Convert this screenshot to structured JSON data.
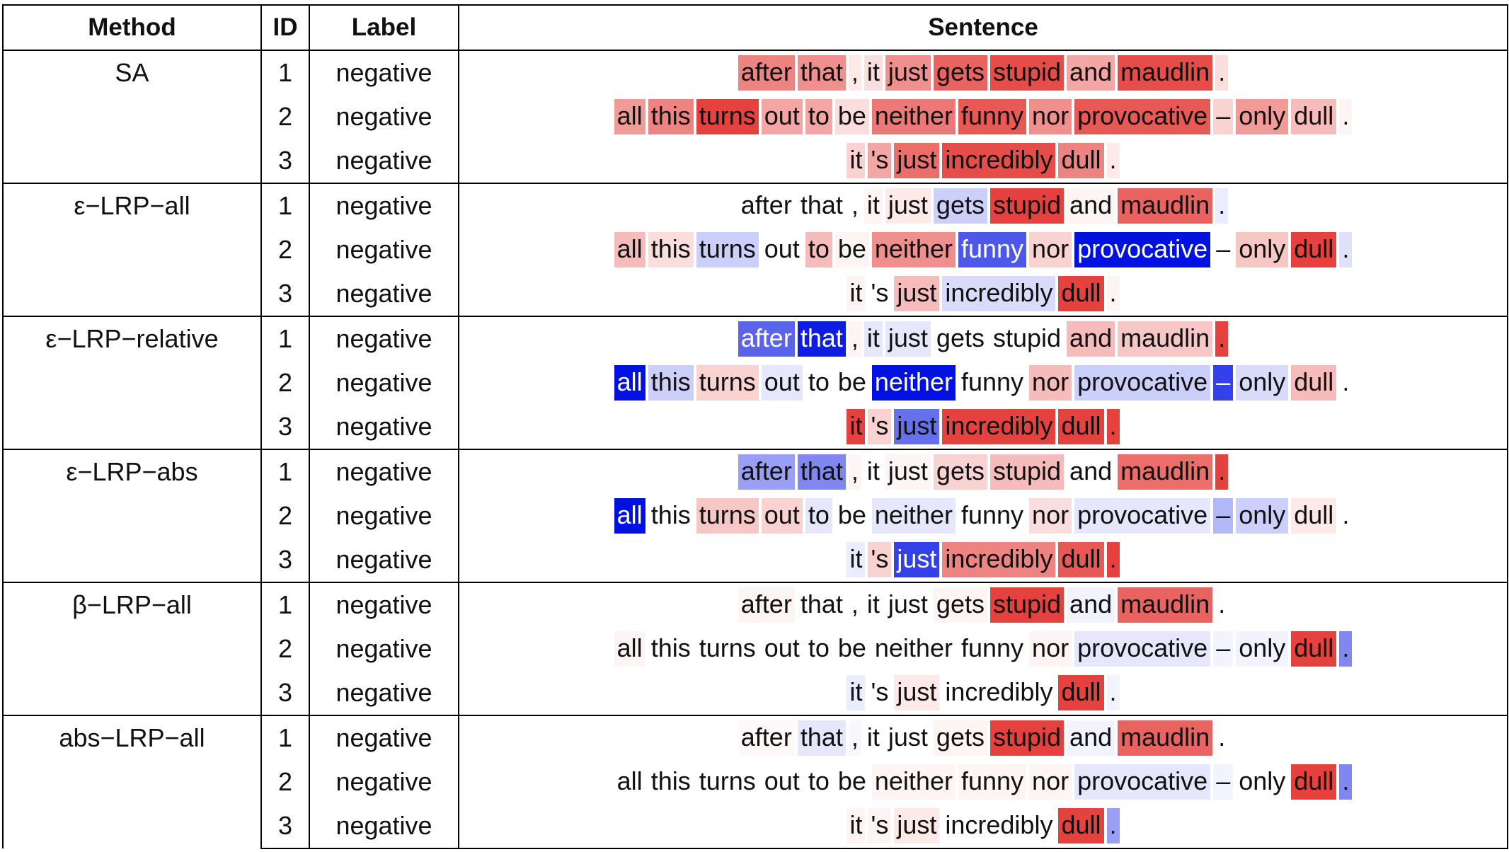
{
  "header": {
    "method": "Method",
    "id": "ID",
    "label": "Label",
    "sentence": "Sentence"
  },
  "sentences": [
    [
      "after",
      "that",
      ",",
      "it",
      "just",
      "gets",
      "stupid",
      "and",
      "maudlin",
      "."
    ],
    [
      "all",
      "this",
      "turns",
      "out",
      "to",
      "be",
      "neither",
      "funny",
      "nor",
      "provocative",
      "–",
      "only",
      "dull",
      "."
    ],
    [
      "it",
      "'s",
      "just",
      "incredibly",
      "dull",
      "."
    ]
  ],
  "methods": [
    {
      "name": "SA",
      "rows": [
        {
          "id": "1",
          "label": "negative",
          "weights": [
            0.55,
            0.5,
            0.1,
            0.15,
            0.5,
            0.7,
            0.8,
            0.4,
            0.8,
            0.15
          ]
        },
        {
          "id": "2",
          "label": "negative",
          "weights": [
            0.45,
            0.55,
            0.85,
            0.4,
            0.4,
            0.15,
            0.6,
            0.75,
            0.5,
            0.75,
            0.2,
            0.45,
            0.3,
            0.05
          ]
        },
        {
          "id": "3",
          "label": "negative",
          "weights": [
            0.2,
            0.4,
            0.65,
            0.8,
            0.55,
            0.1
          ]
        }
      ]
    },
    {
      "name": "ε−LRP−all",
      "rows": [
        {
          "id": "1",
          "label": "negative",
          "weights": [
            0,
            0,
            0,
            0.05,
            0.1,
            -0.2,
            0.85,
            0.05,
            0.7,
            -0.08
          ]
        },
        {
          "id": "2",
          "label": "negative",
          "weights": [
            0.3,
            0.15,
            -0.2,
            0,
            0.3,
            0.05,
            0.5,
            -0.7,
            0.2,
            -1.0,
            0,
            0.25,
            0.85,
            -0.12
          ]
        },
        {
          "id": "3",
          "label": "negative",
          "weights": [
            0.05,
            0,
            0.3,
            -0.15,
            0.85,
            0.05
          ]
        }
      ]
    },
    {
      "name": "ε−LRP−relative",
      "rows": [
        {
          "id": "1",
          "label": "negative",
          "weights": [
            -0.65,
            -0.95,
            0.05,
            -0.1,
            -0.1,
            0,
            0,
            0.3,
            0.25,
            0.85
          ]
        },
        {
          "id": "2",
          "label": "negative",
          "weights": [
            -1.0,
            -0.2,
            0.2,
            -0.1,
            0,
            0,
            -1.0,
            0,
            0.3,
            -0.2,
            -0.8,
            -0.15,
            0.3,
            0
          ]
        },
        {
          "id": "3",
          "label": "negative",
          "weights": [
            0.85,
            0.2,
            -0.6,
            0.85,
            0.85,
            0.85
          ]
        }
      ]
    },
    {
      "name": "ε−LRP−abs",
      "rows": [
        {
          "id": "1",
          "label": "negative",
          "weights": [
            -0.4,
            -0.5,
            0.05,
            0,
            0.05,
            0.2,
            0.3,
            0,
            0.65,
            0.85
          ]
        },
        {
          "id": "2",
          "label": "negative",
          "weights": [
            -1.0,
            0,
            0.25,
            0.2,
            -0.1,
            0,
            -0.1,
            0,
            0.15,
            -0.1,
            -0.3,
            -0.2,
            0.1,
            0
          ]
        },
        {
          "id": "3",
          "label": "negative",
          "weights": [
            -0.08,
            0.2,
            -0.8,
            0.55,
            0.75,
            0.85
          ]
        }
      ]
    },
    {
      "name": "β−LRP−all",
      "rows": [
        {
          "id": "1",
          "label": "negative",
          "weights": [
            0.05,
            0,
            0,
            0,
            0,
            0.05,
            0.85,
            -0.05,
            0.7,
            0
          ]
        },
        {
          "id": "2",
          "label": "negative",
          "weights": [
            0.05,
            0,
            0,
            0,
            0,
            0,
            0,
            0,
            0.05,
            -0.1,
            -0.05,
            -0.05,
            0.85,
            -0.5
          ]
        },
        {
          "id": "3",
          "label": "negative",
          "weights": [
            -0.08,
            0,
            0.1,
            0,
            0.85,
            -0.05
          ]
        }
      ]
    },
    {
      "name": "abs−LRP−all",
      "rows": [
        {
          "id": "1",
          "label": "negative",
          "weights": [
            0.03,
            -0.1,
            -0.03,
            0,
            0,
            0.05,
            0.85,
            -0.05,
            0.7,
            0
          ]
        },
        {
          "id": "2",
          "label": "negative",
          "weights": [
            0,
            0,
            0,
            0,
            0,
            0,
            0.05,
            0.05,
            0.05,
            -0.1,
            -0.05,
            0,
            0.85,
            -0.5
          ]
        },
        {
          "id": "3",
          "label": "negative",
          "weights": [
            0.05,
            0.05,
            0.1,
            0,
            0.85,
            -0.4
          ]
        }
      ]
    }
  ],
  "colors": {
    "positive": "#e0201c",
    "negative": "#0011e0"
  }
}
